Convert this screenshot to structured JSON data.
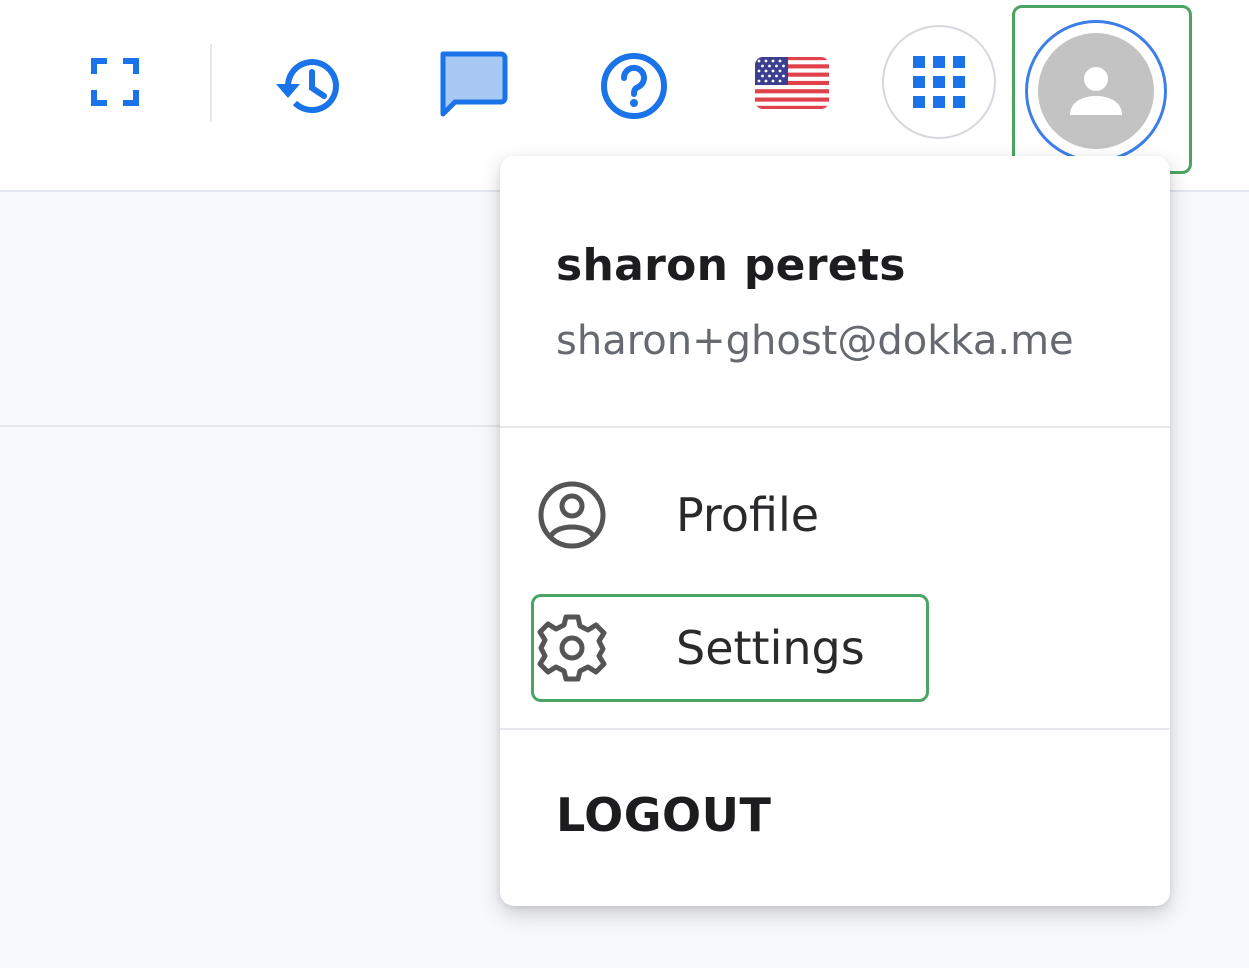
{
  "colors": {
    "accent": "#1a73e8",
    "highlight": "#4aa564",
    "avatar_bg": "#c3c3c3",
    "page_bg": "#f8f9fc"
  },
  "toolbar": {
    "icons": [
      "fullscreen-icon",
      "history-icon",
      "chat-icon",
      "help-icon",
      "us-flag-icon",
      "apps-grid-icon",
      "avatar-icon"
    ]
  },
  "user_menu": {
    "name": "sharon perets",
    "email": "sharon+ghost@dokka.me",
    "items": [
      {
        "label": "Profile",
        "icon": "profile-icon"
      },
      {
        "label": "Settings",
        "icon": "gear-icon"
      }
    ],
    "logout_label": "LOGOUT"
  }
}
